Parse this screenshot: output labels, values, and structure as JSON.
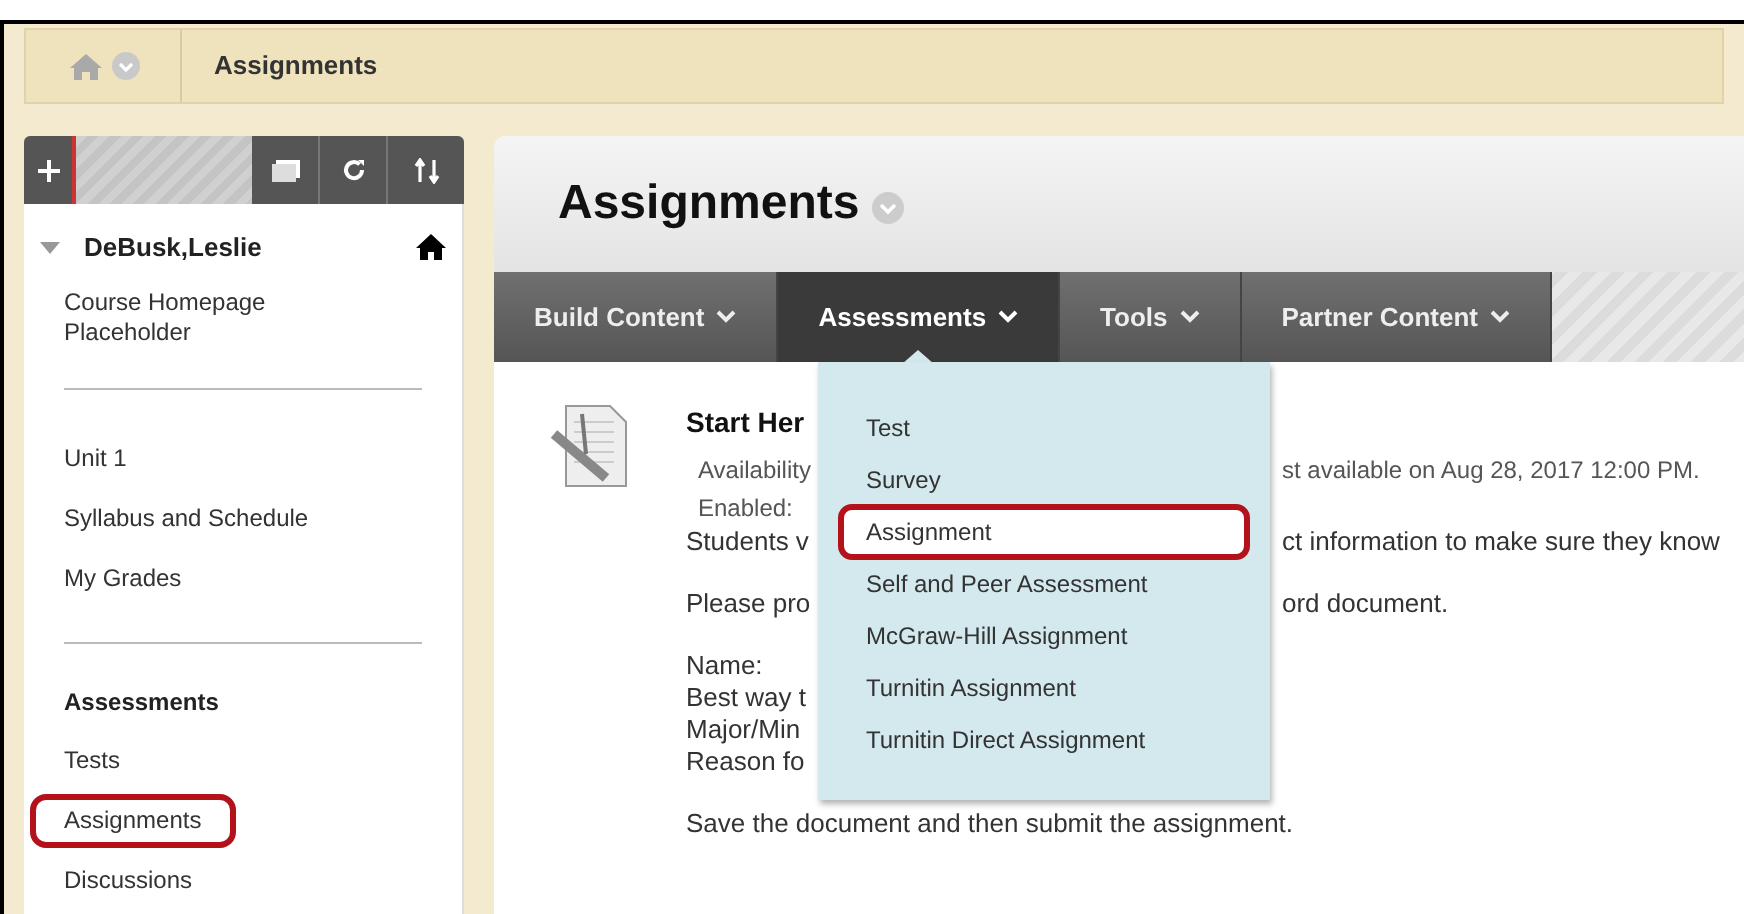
{
  "breadcrumb": {
    "current": "Assignments"
  },
  "sidebar": {
    "course": "DeBusk,Leslie",
    "sections": [
      {
        "items": [
          {
            "label": "Course Homepage Placeholder",
            "highlighted": false
          }
        ]
      },
      {
        "items": [
          {
            "label": "Unit 1",
            "highlighted": false
          },
          {
            "label": "Syllabus and Schedule",
            "highlighted": false
          },
          {
            "label": "My Grades",
            "highlighted": false
          }
        ]
      },
      {
        "heading": "Assessments",
        "items": [
          {
            "label": "Tests",
            "highlighted": false
          },
          {
            "label": "Assignments",
            "highlighted": true
          },
          {
            "label": "Discussions",
            "highlighted": false
          }
        ]
      }
    ]
  },
  "page_title": "Assignments",
  "nav": [
    {
      "label": "Build Content",
      "selected": false
    },
    {
      "label": "Assessments",
      "selected": true
    },
    {
      "label": "Tools",
      "selected": false
    },
    {
      "label": "Partner Content",
      "selected": false
    }
  ],
  "menu": [
    {
      "label": "Test",
      "highlighted": false
    },
    {
      "label": "Survey",
      "highlighted": false
    },
    {
      "label": "Assignment",
      "highlighted": true
    },
    {
      "label": "Self and Peer Assessment",
      "highlighted": false
    },
    {
      "label": "McGraw-Hill Assignment",
      "highlighted": false
    },
    {
      "label": "Turnitin Assignment",
      "highlighted": false
    },
    {
      "label": "Turnitin Direct Assignment",
      "highlighted": false
    }
  ],
  "item": {
    "title": "Start Her",
    "paragraphs": [
      {
        "lines": [
          {
            "left": "Availability",
            "right": "st available on Aug 28, 2017 12:00 PM.",
            "kind": "meta"
          },
          {
            "left": "Enabled:",
            "kind": "meta"
          },
          {
            "left": "Students v",
            "right": "ct information to make sure they know",
            "kind": "body"
          }
        ]
      },
      {
        "lines": [
          {
            "left": "Please pro",
            "right": "ord document.",
            "kind": "body"
          }
        ]
      },
      {
        "lines": [
          {
            "left": "Name:",
            "kind": "body"
          },
          {
            "left": "Best way t",
            "kind": "body"
          },
          {
            "left": "Major/Min",
            "kind": "body"
          },
          {
            "left": "Reason fo",
            "kind": "body"
          }
        ]
      },
      {
        "lines": [
          {
            "left": "Save the document and then submit the assignment.",
            "kind": "body"
          }
        ]
      }
    ]
  }
}
